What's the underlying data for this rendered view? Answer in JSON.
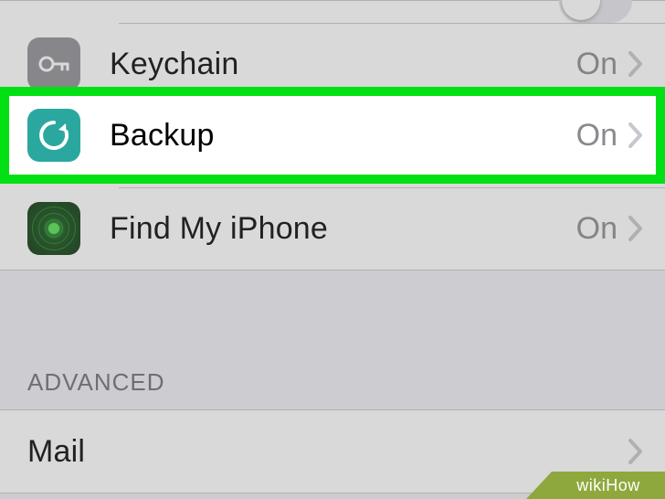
{
  "rows": {
    "keychain": {
      "label": "Keychain",
      "value": "On"
    },
    "backup": {
      "label": "Backup",
      "value": "On"
    },
    "findmy": {
      "label": "Find My iPhone",
      "value": "On"
    },
    "mail": {
      "label": "Mail"
    }
  },
  "sections": {
    "advanced": "Advanced"
  },
  "watermark": "wikiHow"
}
